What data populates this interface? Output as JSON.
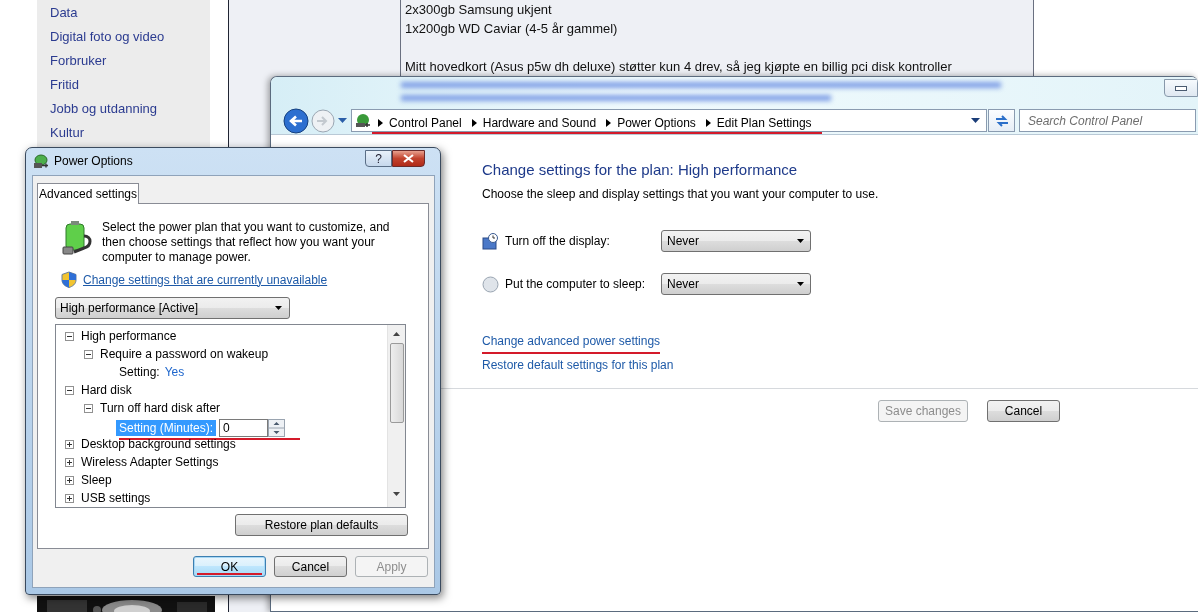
{
  "web_page": {
    "sidebar_links": [
      "Data",
      "Digital foto og video",
      "Forbruker",
      "Fritid",
      "Jobb og utdanning",
      "Kultur"
    ],
    "post_paragraphs": [
      [
        "2x300gb Samsung ukjent",
        "1x200gb WD Caviar (4-5 år gammel)"
      ],
      [
        "Mitt hovedkort (Asus p5w dh deluxe) støtter kun 4 drev, så jeg kjøpte en billig pci disk kontroller"
      ]
    ]
  },
  "control_panel": {
    "breadcrumb": [
      "Control Panel",
      "Hardware and Sound",
      "Power Options",
      "Edit Plan Settings"
    ],
    "breadcrumb_marked": true,
    "search": {
      "placeholder": "Search Control Panel"
    },
    "heading": "Change settings for the plan: High performance",
    "subheading": "Choose the sleep and display settings that you want your computer to use.",
    "settings": [
      {
        "kind": "display",
        "label": "Turn off the display:",
        "value": "Never"
      },
      {
        "kind": "sleep",
        "label": "Put the computer to sleep:",
        "value": "Never"
      }
    ],
    "links": [
      {
        "label": "Change advanced power settings",
        "marked": true
      },
      {
        "label": "Restore default settings for this plan",
        "marked": false
      }
    ],
    "buttons": [
      {
        "label": "Save changes",
        "disabled": true
      },
      {
        "label": "Cancel",
        "disabled": false
      }
    ]
  },
  "dialog": {
    "title": "Power Options",
    "help_button": "?",
    "tabs": [
      {
        "label": "Advanced settings",
        "selected": true
      }
    ],
    "description": "Select the power plan that you want to customize, and then choose settings that reflect how you want your computer to manage power.",
    "link": "Change settings that are currently unavailable",
    "plan": "High performance [Active]",
    "tree": [
      {
        "kind": "group",
        "label": "High performance",
        "expanded": true,
        "children": [
          {
            "kind": "group",
            "label": "Require a password on wakeup",
            "expanded": true,
            "children": [
              {
                "kind": "value",
                "label": "Setting:",
                "value": "Yes"
              }
            ]
          }
        ]
      },
      {
        "kind": "group",
        "label": "Hard disk",
        "expanded": true,
        "children": [
          {
            "kind": "group",
            "label": "Turn off hard disk after",
            "expanded": true,
            "children": [
              {
                "kind": "spinner",
                "label": "Setting (Minutes):",
                "value": "0",
                "selected": true,
                "marked": true
              }
            ]
          }
        ]
      },
      {
        "kind": "group",
        "label": "Desktop background settings",
        "expanded": false
      },
      {
        "kind": "group",
        "label": "Wireless Adapter Settings",
        "expanded": false
      },
      {
        "kind": "group",
        "label": "Sleep",
        "expanded": false
      },
      {
        "kind": "group",
        "label": "USB settings",
        "expanded": false
      }
    ],
    "restore_button": "Restore plan defaults",
    "buttons": [
      {
        "label": "OK",
        "default": true,
        "marked": true,
        "disabled": false
      },
      {
        "label": "Cancel",
        "default": false,
        "marked": false,
        "disabled": false
      },
      {
        "label": "Apply",
        "default": false,
        "marked": false,
        "disabled": true
      }
    ]
  }
}
